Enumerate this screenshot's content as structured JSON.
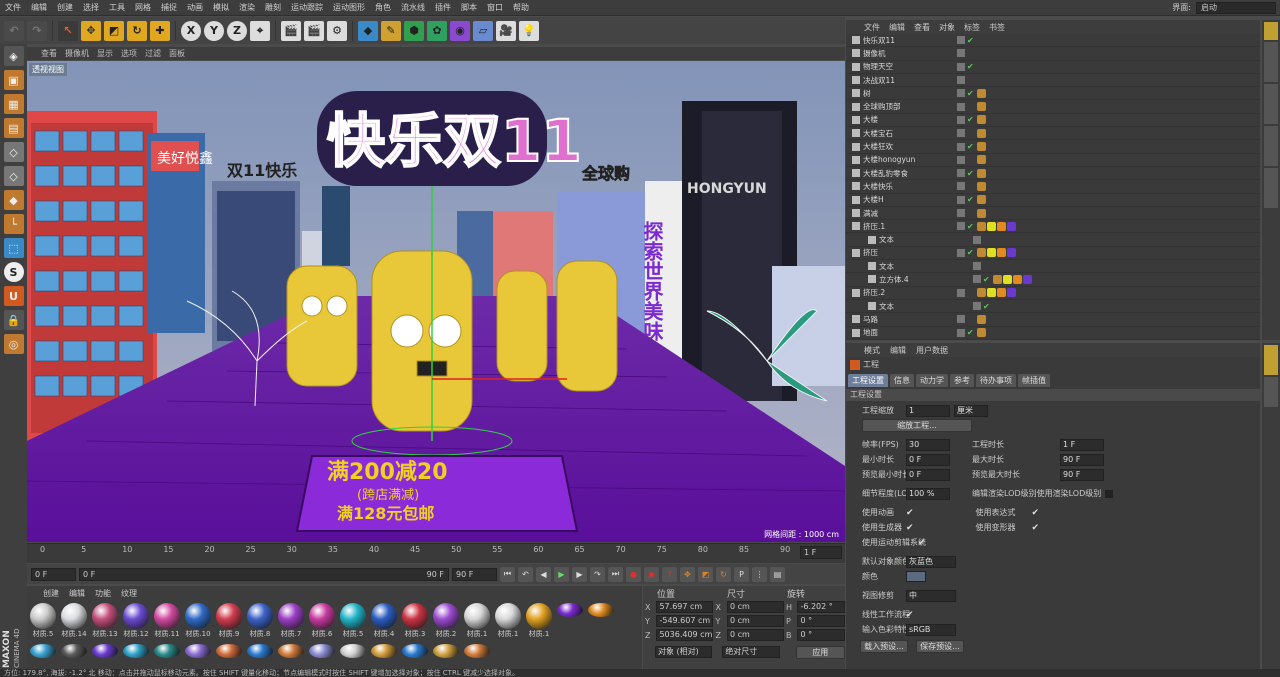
{
  "menus": [
    "文件",
    "编辑",
    "创建",
    "选择",
    "工具",
    "网格",
    "捕捉",
    "动画",
    "模拟",
    "渲染",
    "雕刻",
    "运动跟踪",
    "运动图形",
    "角色",
    "流水线",
    "插件",
    "脚本",
    "窗口",
    "帮助"
  ],
  "layout": {
    "label": "界面:",
    "value": "启动"
  },
  "toolbar": {
    "x": "X",
    "y": "Y",
    "z": "Z"
  },
  "viewport": {
    "menus": [
      "查看",
      "摄像机",
      "显示",
      "选项",
      "过滤",
      "面板"
    ],
    "label": "透视视图",
    "grid_spacing": "网格间距 : 1000 cm",
    "billboard_title": "快乐双11",
    "sign_a": "双11快乐",
    "sign_b": "全球购",
    "sign_c": "HONGYUN",
    "sign_d": "探索世界美味",
    "promo_line1": "满200减20",
    "promo_line2": "(跨店满减)",
    "promo_line3": "满128元包邮",
    "building_sign": "美好悦鑫"
  },
  "timeline": {
    "ticks": [
      "0",
      "5",
      "10",
      "15",
      "20",
      "25",
      "30",
      "35",
      "40",
      "45",
      "50",
      "55",
      "60",
      "65",
      "70",
      "75",
      "80",
      "85",
      "90"
    ],
    "end_frame": "1 F",
    "start": "0 F",
    "range_start": "0 F",
    "range_end": "90 F",
    "end": "90 F"
  },
  "materials": {
    "menu": [
      "创建",
      "编辑",
      "功能",
      "纹理"
    ],
    "items": [
      {
        "label": "材质.5",
        "color": "#c9c9c9"
      },
      {
        "label": "材质.14",
        "color": "#d8dbe0"
      },
      {
        "label": "材质.13",
        "color": "#c24e7a"
      },
      {
        "label": "材质.12",
        "color": "#6a4ad0"
      },
      {
        "label": "材质.11",
        "color": "#d24aa0"
      },
      {
        "label": "材质.10",
        "color": "#2f69c4"
      },
      {
        "label": "材质.9",
        "color": "#d23c4e"
      },
      {
        "label": "材质.8",
        "color": "#3b62c9"
      },
      {
        "label": "材质.7",
        "color": "#9c3ec4"
      },
      {
        "label": "材质.6",
        "color": "#c83aa0"
      },
      {
        "label": "材质.5",
        "color": "#21b4c8"
      },
      {
        "label": "材质.4",
        "color": "#2a5cc0"
      },
      {
        "label": "材质.3",
        "color": "#cc3344"
      },
      {
        "label": "材质.2",
        "color": "#9a4ad0"
      },
      {
        "label": "材质.1",
        "color": "#d6d6d6"
      },
      {
        "label": "材质.1",
        "color": "#d8d8d8"
      },
      {
        "label": "材质.1",
        "color": "#e0a020"
      }
    ],
    "row2": [
      "#7a2ad0",
      "#e08a20",
      "#3aa0d0",
      "#5a5a5a",
      "#6a3ad0",
      "#30a0c8",
      "#2a8a8a",
      "#8a6ad0",
      "#d06a3a",
      "#2a7ad0",
      "#d07a3a",
      "#8a8ad0",
      "#d0d0d0",
      "#d09a3a",
      "#2a7ad0",
      "#d0a040",
      "#d07a3a"
    ]
  },
  "coords": {
    "headers": [
      "位置",
      "尺寸",
      "旋转"
    ],
    "rows": [
      {
        "axis": "X",
        "pos": "57.697 cm",
        "size": "0 cm",
        "rlbl": "H",
        "rot": "-6.202 °"
      },
      {
        "axis": "Y",
        "pos": "-549.607 cm",
        "size": "0 cm",
        "rlbl": "P",
        "rot": "0 °"
      },
      {
        "axis": "Z",
        "pos": "5036.409 cm",
        "size": "0 cm",
        "rlbl": "B",
        "rot": "0 °"
      }
    ],
    "mode": "对象 (相对)",
    "sizemode": "绝对尺寸",
    "apply": "应用"
  },
  "objects": {
    "menu": [
      "文件",
      "编辑",
      "查看",
      "对象",
      "标签",
      "书签"
    ],
    "rows": [
      "快乐双11",
      "摄像机",
      "物理天空",
      "决战双11",
      "树",
      "全球购顶部",
      "大楼",
      "大楼宝石",
      "大楼狂欢",
      "大楼honogyun",
      "大楼乱豹零食",
      "大楼快乐",
      "大楼H",
      "满减",
      "挤压.1",
      "文本",
      "挤压",
      "文本",
      "立方体.4",
      "挤压.2",
      "文本",
      "马路",
      "地面"
    ]
  },
  "attributes": {
    "menu": [
      "模式",
      "编辑",
      "用户数据"
    ],
    "title": "工程",
    "tabs": [
      "工程设置",
      "信息",
      "动力学",
      "参考",
      "待办事项",
      "帧插值"
    ],
    "section": "工程设置",
    "scale_label": "工程缩放",
    "scale_value": "1",
    "scale_unit": "厘米",
    "scale_btn": "缩放工程...",
    "fps_label": "帧率(FPS)",
    "fps": "30",
    "mintime_label": "最小时长",
    "mintime": "0 F",
    "previewmin_label": "预览最小时长",
    "previewmin": "0 F",
    "duration_label": "工程时长",
    "duration": "1 F",
    "maxtime_label": "最大时长",
    "maxtime": "90 F",
    "previewmax_label": "预览最大时长",
    "previewmax": "90 F",
    "lod_label": "细节程度(LOD)",
    "lod": "100 %",
    "lod_render": "编辑渲染LOD级别使用渲染LOD级别",
    "anim": "使用动画",
    "expr": "使用表达式",
    "gen": "使用生成器",
    "deform": "使用变形器",
    "motion": "使用运动剪辑系统",
    "defcolor_label": "默认对象颜色",
    "defcolor": "灰蓝色",
    "color_label": "颜色",
    "clip_label": "视图修剪",
    "clip": "中",
    "linear_label": "线性工作流程",
    "input_label": "输入色彩特性",
    "input": "sRGB",
    "load_btn": "载入预设...",
    "save_btn": "保存预设..."
  },
  "status": "方位: 179.8°, 海拔: -1.2° 北   移动：点击并拖动鼠标移动元素。按住 SHIFT 键量化移动；节点编辑模式时按住 SHIFT 键增加选择对象；按住 CTRL 键减少选择对象。",
  "brand": {
    "top": "MAXON",
    "bottom": "CINEMA 4D"
  }
}
